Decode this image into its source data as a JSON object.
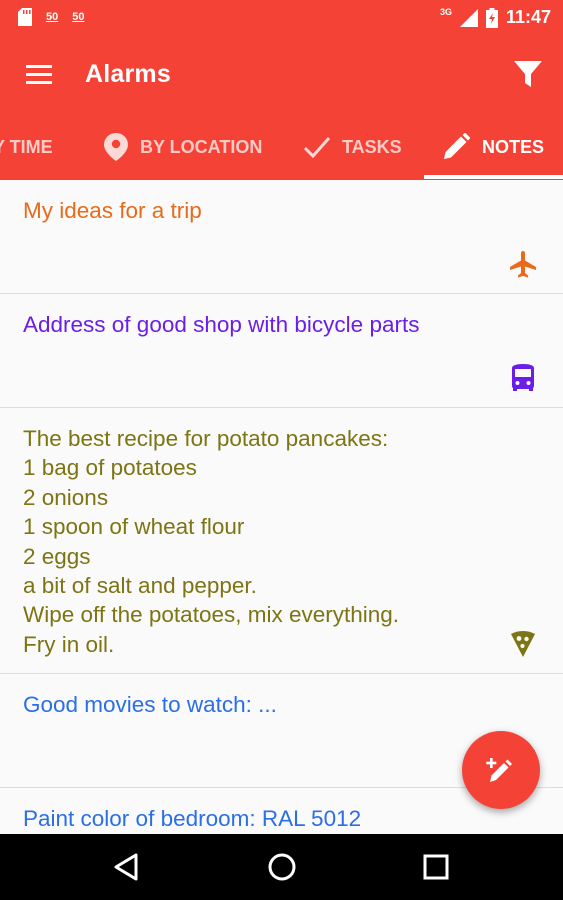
{
  "status_bar": {
    "badges": [
      "50",
      "50"
    ],
    "network": "3G",
    "time": "11:47"
  },
  "app_bar": {
    "title": "Alarms",
    "menu_icon": "hamburger-menu-icon",
    "filter_icon": "filter-funnel-icon"
  },
  "tabs": [
    {
      "label": "BY TIME",
      "icon": "clock-icon",
      "active": false
    },
    {
      "label": "BY LOCATION",
      "icon": "location-pin-icon",
      "active": false
    },
    {
      "label": "TASKS",
      "icon": "checkmark-icon",
      "active": false
    },
    {
      "label": "NOTES",
      "icon": "pencil-icon",
      "active": true
    }
  ],
  "notes": [
    {
      "text": "My ideas for a trip",
      "color": "#e86a1a",
      "icon": "airplane-icon"
    },
    {
      "text": "Address of good shop with bicycle parts",
      "color": "#6a1ee8",
      "icon": "bus-icon"
    },
    {
      "text": "The best recipe for potato pancakes:\n1 bag of potatoes\n2 onions\n1 spoon of wheat flour\n2 eggs\na bit of salt and pepper.\nWipe off the potatoes, mix everything.\nFry in oil.",
      "color": "#7d7414",
      "icon": "pizza-slice-icon"
    },
    {
      "text": "Good movies to watch: ...",
      "color": "#2a6ee8",
      "icon": "movie-icon"
    },
    {
      "text": "Paint color of bedroom: RAL 5012",
      "color": "#2a6ee8",
      "icon": ""
    }
  ],
  "fab": {
    "icon": "new-note-icon"
  },
  "colors": {
    "primary": "#f44336",
    "divider": "#dcdcdc",
    "background": "#fafafa"
  }
}
